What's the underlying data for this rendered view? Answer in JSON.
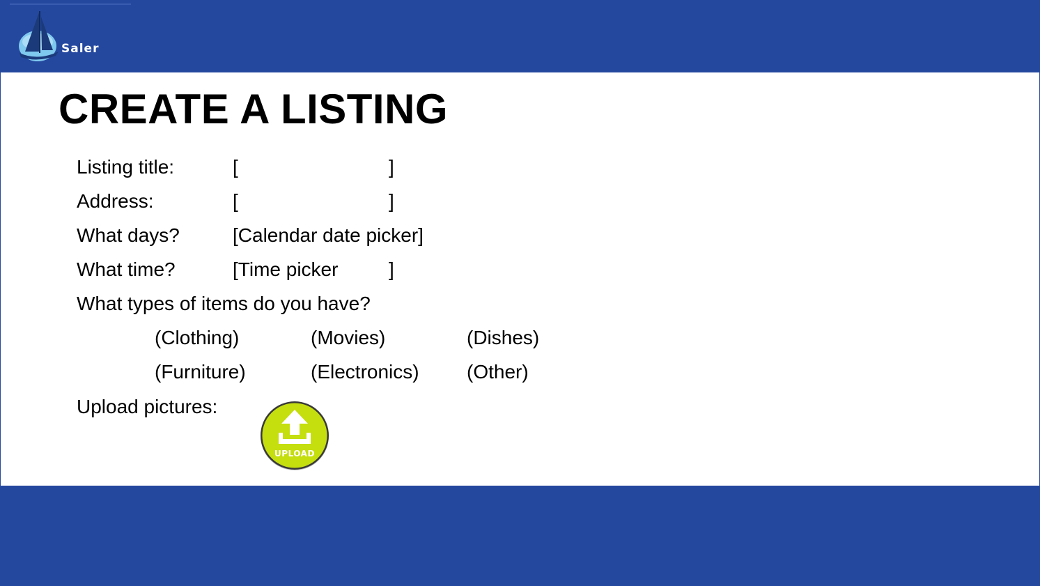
{
  "brand": {
    "name": "Saler",
    "logo_icon": "sailboat-icon"
  },
  "page": {
    "title": "CREATE A LISTING"
  },
  "form": {
    "listing_title": {
      "label": "Listing title:",
      "value": ""
    },
    "address": {
      "label": "Address:",
      "value": ""
    },
    "days": {
      "label": "What days?",
      "value": "[Calendar date picker]"
    },
    "time": {
      "label": "What time?",
      "value": "[Time picker"
    },
    "item_types": {
      "label": "What types of items do you have?",
      "options": [
        "(Clothing)",
        "(Movies)",
        "(Dishes)",
        "(Furniture)",
        "(Electronics)",
        "(Other)"
      ]
    },
    "upload": {
      "label": "Upload pictures:",
      "button_label": "UPLOAD",
      "icon": "upload-arrow-icon"
    }
  },
  "colors": {
    "brand_blue": "#25489f",
    "upload_green": "#c5de0e"
  }
}
